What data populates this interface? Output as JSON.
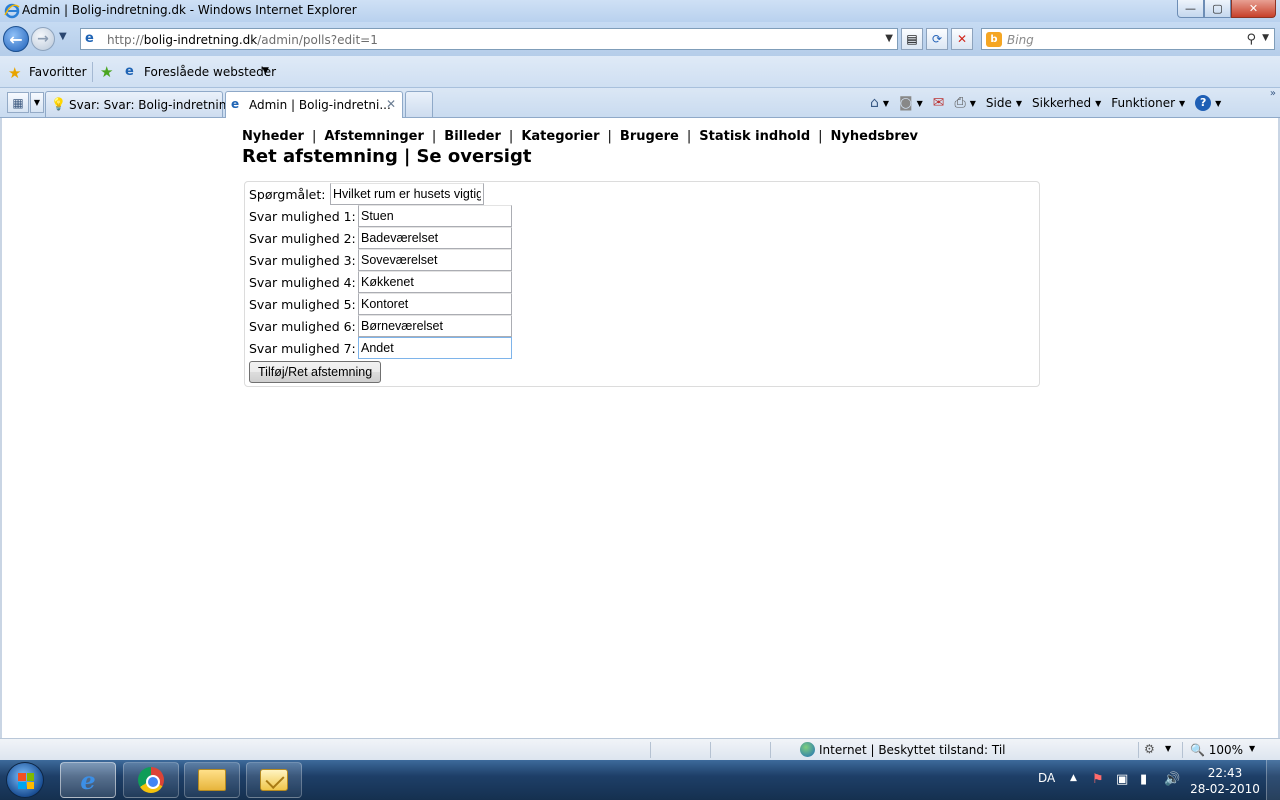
{
  "window": {
    "title": "Admin | Bolig-indretning.dk - Windows Internet Explorer",
    "btn_min": "—",
    "btn_max": "▢",
    "btn_close": "✕"
  },
  "address_bar": {
    "url_prefix": "http://",
    "url_domain": "bolig-indretning.dk",
    "url_path": "/admin/polls?edit=1"
  },
  "search": {
    "engine_icon": "b",
    "placeholder": "Bing"
  },
  "favorites": {
    "label": "Favoritter",
    "suggested_sites": "Foreslåede websteder"
  },
  "tabs": [
    {
      "label": "Svar: Svar: Bolig-indretnin...",
      "icon": "lightbulb-icon",
      "active": false
    },
    {
      "label": "Admin | Bolig-indretni...",
      "icon": "ie-page-icon",
      "active": true
    }
  ],
  "command_bar": {
    "page": "Side",
    "safety": "Sikkerhed",
    "tools": "Funktioner",
    "help": "?"
  },
  "site_nav": {
    "items": [
      "Nyheder",
      "Afstemninger",
      "Billeder",
      "Kategorier",
      "Brugere",
      "Statisk indhold",
      "Nyhedsbrev"
    ],
    "separator": "|"
  },
  "page": {
    "heading_left": "Ret afstemning",
    "heading_sep": "|",
    "heading_right": "Se oversigt"
  },
  "form": {
    "question_label": "Spørgmålet:",
    "question_value": "Hvilket rum er husets vigtigste?",
    "answers": [
      {
        "label": "Svar mulighed 1:",
        "value": "Stuen"
      },
      {
        "label": "Svar mulighed 2:",
        "value": "Badeværelset"
      },
      {
        "label": "Svar mulighed 3:",
        "value": "Soveværelset"
      },
      {
        "label": "Svar mulighed 4:",
        "value": "Køkkenet"
      },
      {
        "label": "Svar mulighed 5:",
        "value": "Kontoret"
      },
      {
        "label": "Svar mulighed 6:",
        "value": "Børneværelset"
      },
      {
        "label": "Svar mulighed 7:",
        "value": "Andet"
      }
    ],
    "submit_label": "Tilføj/Ret afstemning"
  },
  "status_bar": {
    "zone": "Internet | Beskyttet tilstand: Til",
    "zoom": "100%"
  },
  "taskbar": {
    "language": "DA",
    "time": "22:43",
    "date": "28-02-2010"
  }
}
